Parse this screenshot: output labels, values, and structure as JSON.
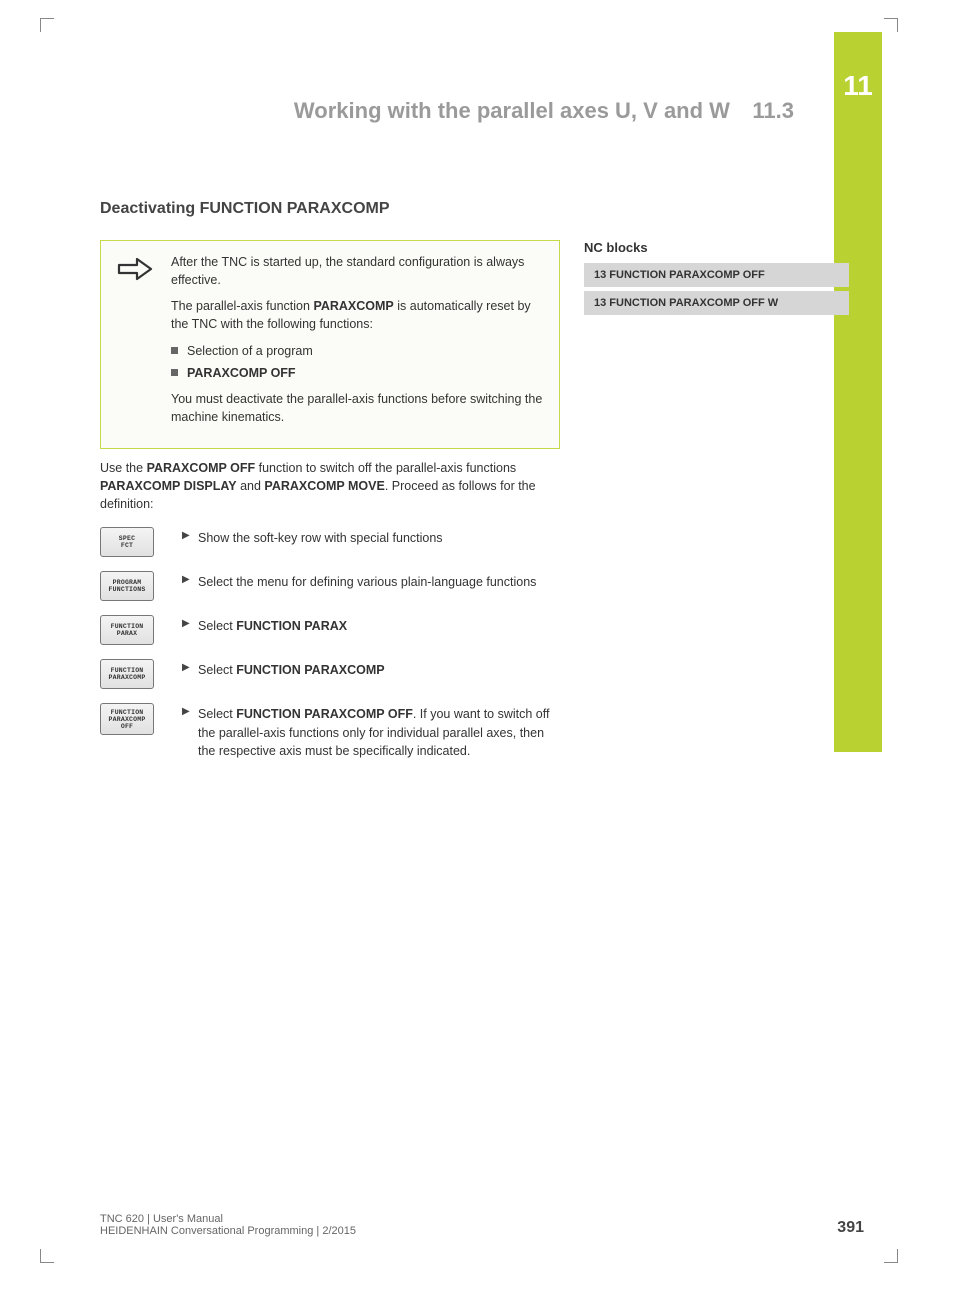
{
  "chapter": {
    "number": "11",
    "title": "Working with the parallel axes U, V and W",
    "section": "11.3"
  },
  "section_title": "Deactivating FUNCTION PARAXCOMP",
  "note": {
    "p1": "After the TNC is started up, the standard configuration is always effective.",
    "p2_pre": "The parallel-axis function ",
    "p2_bold": "PARAXCOMP",
    "p2_post": " is automatically reset by the TNC with the following functions:",
    "bullets": [
      {
        "text": "Selection of a program",
        "bold": false
      },
      {
        "text": "PARAXCOMP OFF",
        "bold": true
      }
    ],
    "p3": "You must deactivate the parallel-axis functions before switching the machine kinematics."
  },
  "intro": {
    "t1": "Use the ",
    "b1": "PARAXCOMP OFF",
    "t2": " function to switch off the parallel-axis functions ",
    "b2": "PARAXCOMP DISPLAY",
    "t3": " and ",
    "b3": "PARAXCOMP MOVE",
    "t4": ". Proceed as follows for the definition:"
  },
  "steps": [
    {
      "key": "SPEC\nFCT",
      "text": "Show the soft-key row with special functions"
    },
    {
      "key": "PROGRAM\nFUNCTIONS",
      "text": "Select the menu for defining various plain-language functions"
    },
    {
      "key": "FUNCTION\nPARAX",
      "text_pre": "Select ",
      "text_bold": "FUNCTION PARAX"
    },
    {
      "key": "FUNCTION\nPARAXCOMP",
      "text_pre": "Select ",
      "text_bold": "FUNCTION PARAXCOMP"
    },
    {
      "key": "FUNCTION\nPARAXCOMP\nOFF",
      "text_pre": "Select ",
      "text_bold": "FUNCTION PARAXCOMP OFF",
      "text_post": ". If you want to switch off the parallel-axis functions only for individual parallel axes, then the respective axis must be specifically indicated."
    }
  ],
  "nc": {
    "title": "NC blocks",
    "rows": [
      "13 FUNCTION PARAXCOMP OFF",
      "13 FUNCTION PARAXCOMP OFF W"
    ]
  },
  "footer": {
    "line1": "TNC 620 | User's Manual",
    "line2": "HEIDENHAIN Conversational Programming | 2/2015",
    "page": "391"
  }
}
